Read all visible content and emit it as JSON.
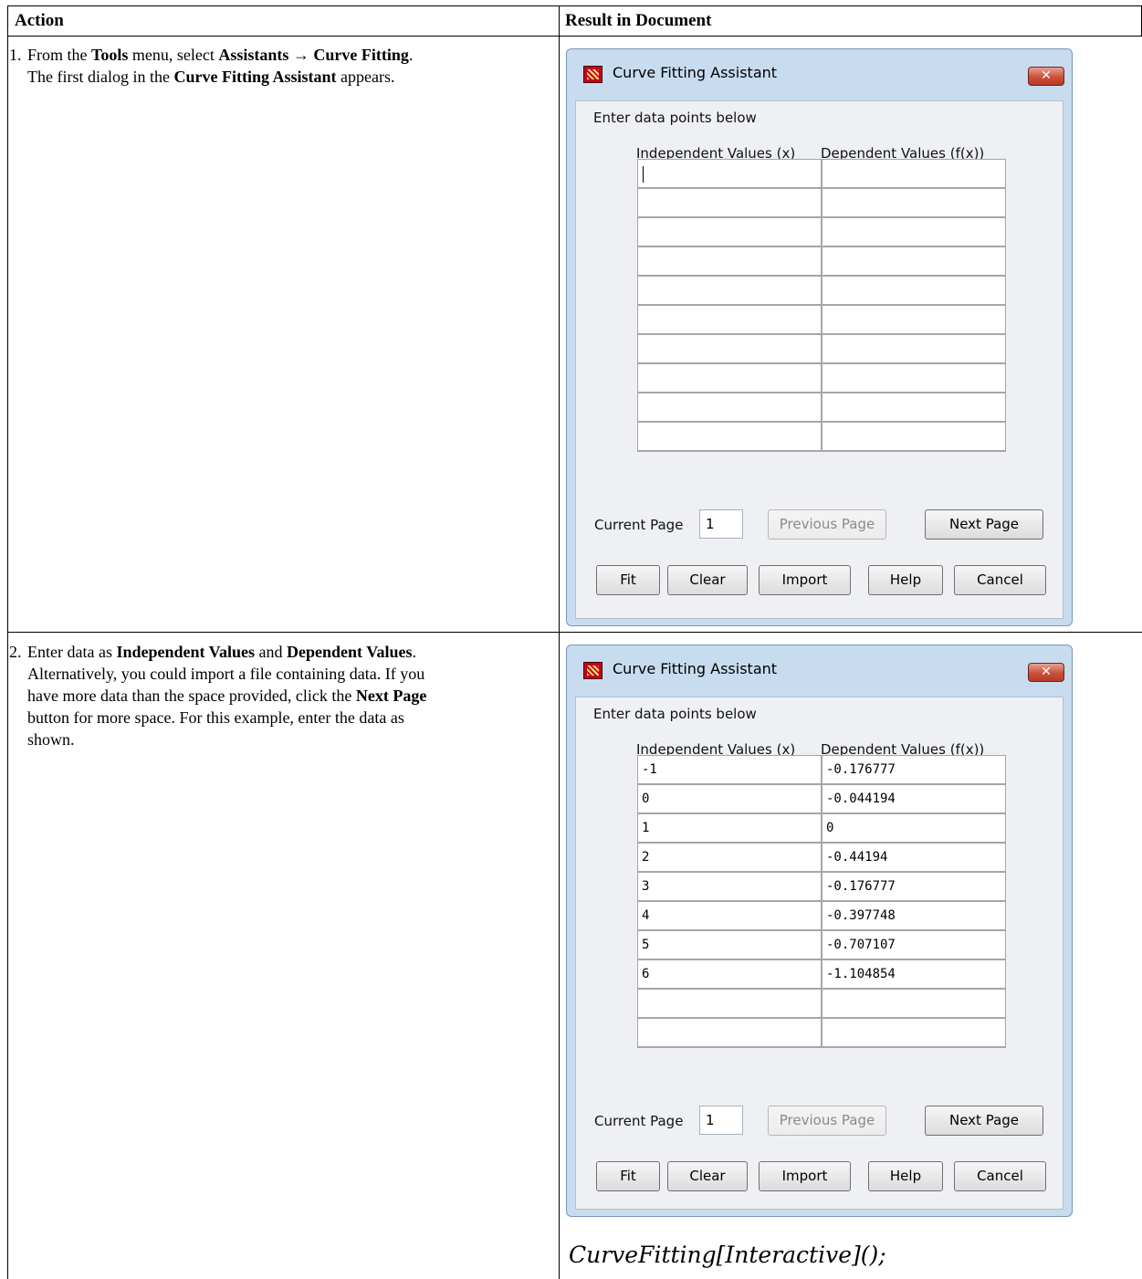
{
  "table": {
    "header_action": "Action",
    "header_result": "Result in Document"
  },
  "steps": [
    {
      "number": "1.",
      "lines": [
        [
          "From the ",
          {
            "b": "Tools"
          },
          " menu, select ",
          {
            "b": "Assistants → Curve Fitting"
          },
          "."
        ],
        [
          "The first dialog in the ",
          {
            "b": "Curve Fitting Assistant"
          },
          " appears."
        ]
      ]
    },
    {
      "number": "2.",
      "lines": [
        [
          "Enter data as ",
          {
            "b": "Independent Values"
          },
          " and ",
          {
            "b": "Dependent Values"
          },
          "."
        ],
        [
          "Alternatively, you could import a file containing data. If you"
        ],
        [
          "have more data than the space provided, click the ",
          {
            "b": "Next Page"
          }
        ],
        [
          "button for more space. For this example, enter the data as"
        ],
        [
          "shown."
        ]
      ]
    }
  ],
  "dialogs": [
    {
      "title": "Curve Fitting Assistant",
      "close_label": "✕",
      "prompt": "Enter data points below",
      "col_x": "Independent Values (x)",
      "col_fx": "Dependent Values (f(x))",
      "rows": [
        [
          "",
          ""
        ],
        [
          "",
          ""
        ],
        [
          "",
          ""
        ],
        [
          "",
          ""
        ],
        [
          "",
          ""
        ],
        [
          "",
          ""
        ],
        [
          "",
          ""
        ],
        [
          "",
          ""
        ],
        [
          "",
          ""
        ],
        [
          "",
          ""
        ]
      ],
      "current_page_label": "Current Page",
      "current_page_value": "1",
      "prev_label": "Previous Page",
      "next_label": "Next Page",
      "buttons": [
        "Fit",
        "Clear",
        "Import",
        "Help",
        "Cancel"
      ]
    },
    {
      "title": "Curve Fitting Assistant",
      "close_label": "✕",
      "prompt": "Enter data points below",
      "col_x": "Independent Values (x)",
      "col_fx": "Dependent Values (f(x))",
      "rows": [
        [
          "-1",
          "-0.176777"
        ],
        [
          "0",
          "-0.044194"
        ],
        [
          "1",
          "0"
        ],
        [
          "2",
          "-0.44194"
        ],
        [
          "3",
          "-0.176777"
        ],
        [
          "4",
          "-0.397748"
        ],
        [
          "5",
          "-0.707107"
        ],
        [
          "6",
          "-1.104854"
        ],
        [
          "",
          ""
        ],
        [
          "",
          ""
        ]
      ],
      "current_page_label": "Current Page",
      "current_page_value": "1",
      "prev_label": "Previous Page",
      "next_label": "Next Page",
      "buttons": [
        "Fit",
        "Clear",
        "Import",
        "Help",
        "Cancel"
      ]
    }
  ],
  "code": "CurveFitting[Interactive]();",
  "colors": {
    "dialog_frame": "#c8dcf0",
    "dialog_body": "#eef0f3",
    "close_button": "#c9503a"
  }
}
